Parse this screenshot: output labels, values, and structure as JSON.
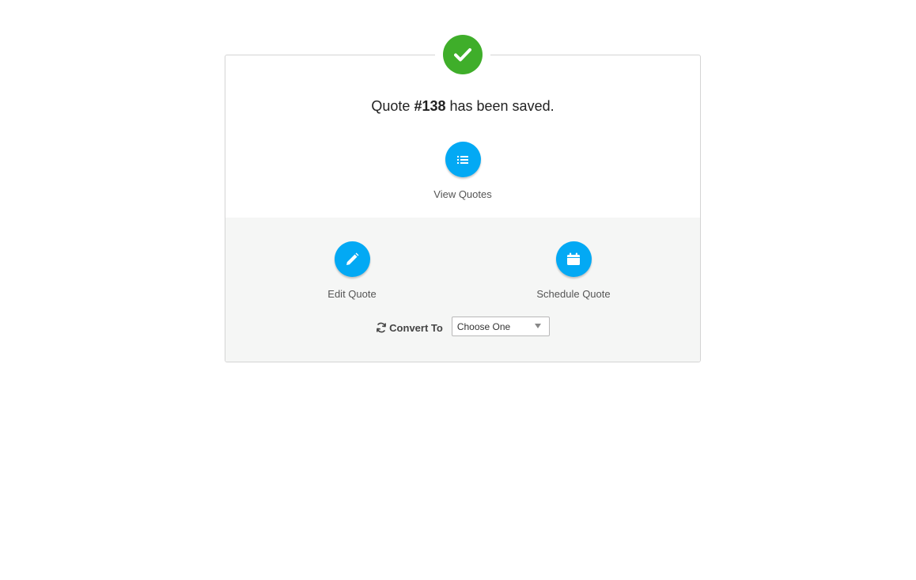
{
  "status": {
    "icon": "checkmark-icon",
    "color": "#3fae2a"
  },
  "message": {
    "prefix": "Quote ",
    "quote_number": "#138",
    "suffix": " has been saved."
  },
  "actions": {
    "view_quotes": {
      "label": "View Quotes",
      "icon": "list-icon"
    },
    "edit_quote": {
      "label": "Edit Quote",
      "icon": "pencil-icon"
    },
    "schedule_quote": {
      "label": "Schedule Quote",
      "icon": "calendar-icon"
    }
  },
  "convert": {
    "icon": "refresh-icon",
    "label": "Convert To",
    "selected": "Choose One"
  },
  "colors": {
    "action_blue": "#03a9f4",
    "success_green": "#3fae2a",
    "panel_gray": "#f5f6f5"
  }
}
